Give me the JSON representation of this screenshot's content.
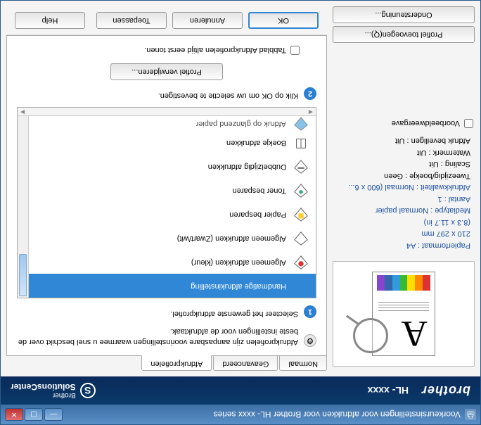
{
  "titlebar": {
    "icon_label": "printer-icon",
    "title": "Voorkeursinstellingen voor afdrukken voor Brother HL- xxxx  series"
  },
  "brandbar": {
    "logo": "brother",
    "model": "HL- xxxx",
    "solutions_l1": "Brother",
    "solutions_l2": "SolutionsCenter"
  },
  "left": {
    "settings": [
      "Papierformaat : A4",
      "210 x 297 mm",
      "(8.3 x 11.7 in)",
      "Mediatype : Normaal papier",
      "Aantal : 1",
      "Afdrukkwaliteit : Normaal (600 x 6..."
    ],
    "settings_black": [
      "Tweezijdig/boekje : Geen",
      "Scaling : Uit",
      "Watermerk : Uit",
      "Afdruk beveiligen : Uit"
    ],
    "preview_checkbox": "Voorbeeldweergave",
    "btn_add_profile": "Profiel toevoegen(Q)...",
    "btn_support": "Ondersteuning..."
  },
  "tabs": {
    "normal": "Normaal",
    "advanced": "Geavanceerd",
    "profiles": "Afdrukprofielen"
  },
  "panel": {
    "intro": "Afdrukprofielen zijn aanpasbare voorinstellingen waarmee u snel beschikt over de beste instellingen voor de afdruktaak.",
    "step1": "Selecteer het gewenste afdrukprofiel.",
    "items": [
      {
        "label": "Handmatige afdrukinstelling"
      },
      {
        "label": "Algemeen afdrukken (kleur)"
      },
      {
        "label": "Algemeen afdrukken (Zwart/wit)"
      },
      {
        "label": "Papier besparen"
      },
      {
        "label": "Toner besparen"
      },
      {
        "label": "Dubbelzijdig afdrukken"
      },
      {
        "label": "Boekje afdrukken"
      },
      {
        "label": "Afdruk op glanzend papier"
      }
    ],
    "step2": "Klik op OK om uw selectie te bevestigen.",
    "btn_delete": "Profiel verwijderen...",
    "always_show": "Tabblad Afdrukprofielen altijd eerst tonen."
  },
  "buttons": {
    "ok": "OK",
    "cancel": "Annuleren",
    "apply": "Toepassen",
    "help": "Help"
  }
}
